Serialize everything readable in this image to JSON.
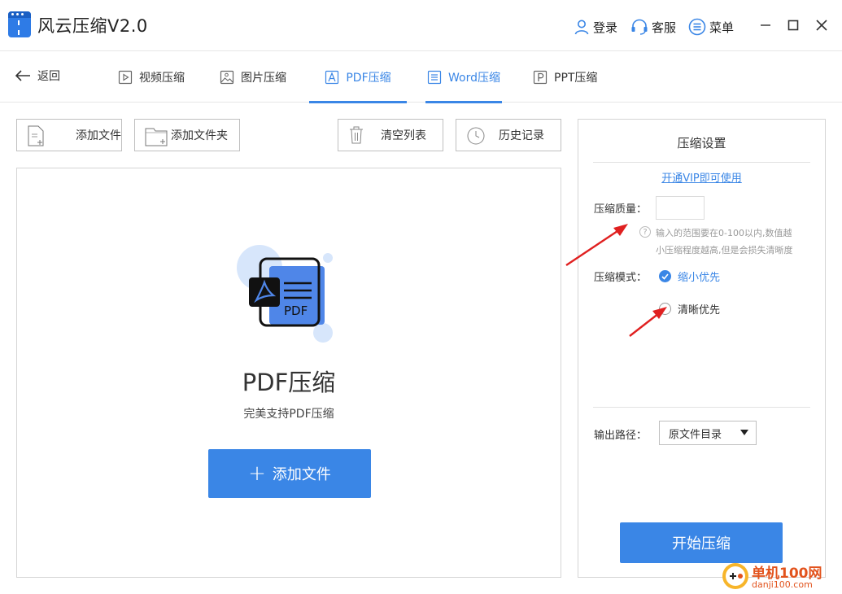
{
  "app": {
    "title": "风云压缩V2.0"
  },
  "top_actions": {
    "login": "登录",
    "service": "客服",
    "menu": "菜单"
  },
  "nav": {
    "back": "返回",
    "tabs": [
      {
        "label": "视频压缩",
        "icon": "video-icon",
        "active": false
      },
      {
        "label": "图片压缩",
        "icon": "image-icon",
        "active": false
      },
      {
        "label": "PDF压缩",
        "icon": "pdf-icon",
        "active": true
      },
      {
        "label": "Word压缩",
        "icon": "word-icon",
        "active": true
      },
      {
        "label": "PPT压缩",
        "icon": "ppt-icon",
        "active": false
      }
    ]
  },
  "toolbar": {
    "add_file": "添加文件",
    "add_folder": "添加文件夹",
    "clear_list": "清空列表",
    "history": "历史记录"
  },
  "drop_area": {
    "badge_text": "PDF",
    "title": "PDF压缩",
    "subtitle": "完美支持PDF压缩",
    "add_button": "添加文件",
    "add_button_symbol": "+"
  },
  "settings": {
    "title": "压缩设置",
    "vip_link": "开通VIP即可使用",
    "quality_label": "压缩质量：",
    "quality_value": "",
    "help_symbol": "?",
    "hint_line1": "输入的范围要在0-100以内,数值越",
    "hint_line2": "小压缩程度越高,但是会损失清晰度",
    "mode_label": "压缩模式：",
    "modes": [
      {
        "label": "缩小优先",
        "selected": true
      },
      {
        "label": "清晰优先",
        "selected": false
      }
    ],
    "output_label": "输出路径：",
    "output_value": "原文件目录",
    "start_button": "开始压缩"
  },
  "watermark": {
    "line1": "单机100网",
    "line2": "danji100.com"
  },
  "colors": {
    "accent": "#3a86e6",
    "annotation_arrow": "#e02020",
    "watermark": "#e2531d"
  }
}
